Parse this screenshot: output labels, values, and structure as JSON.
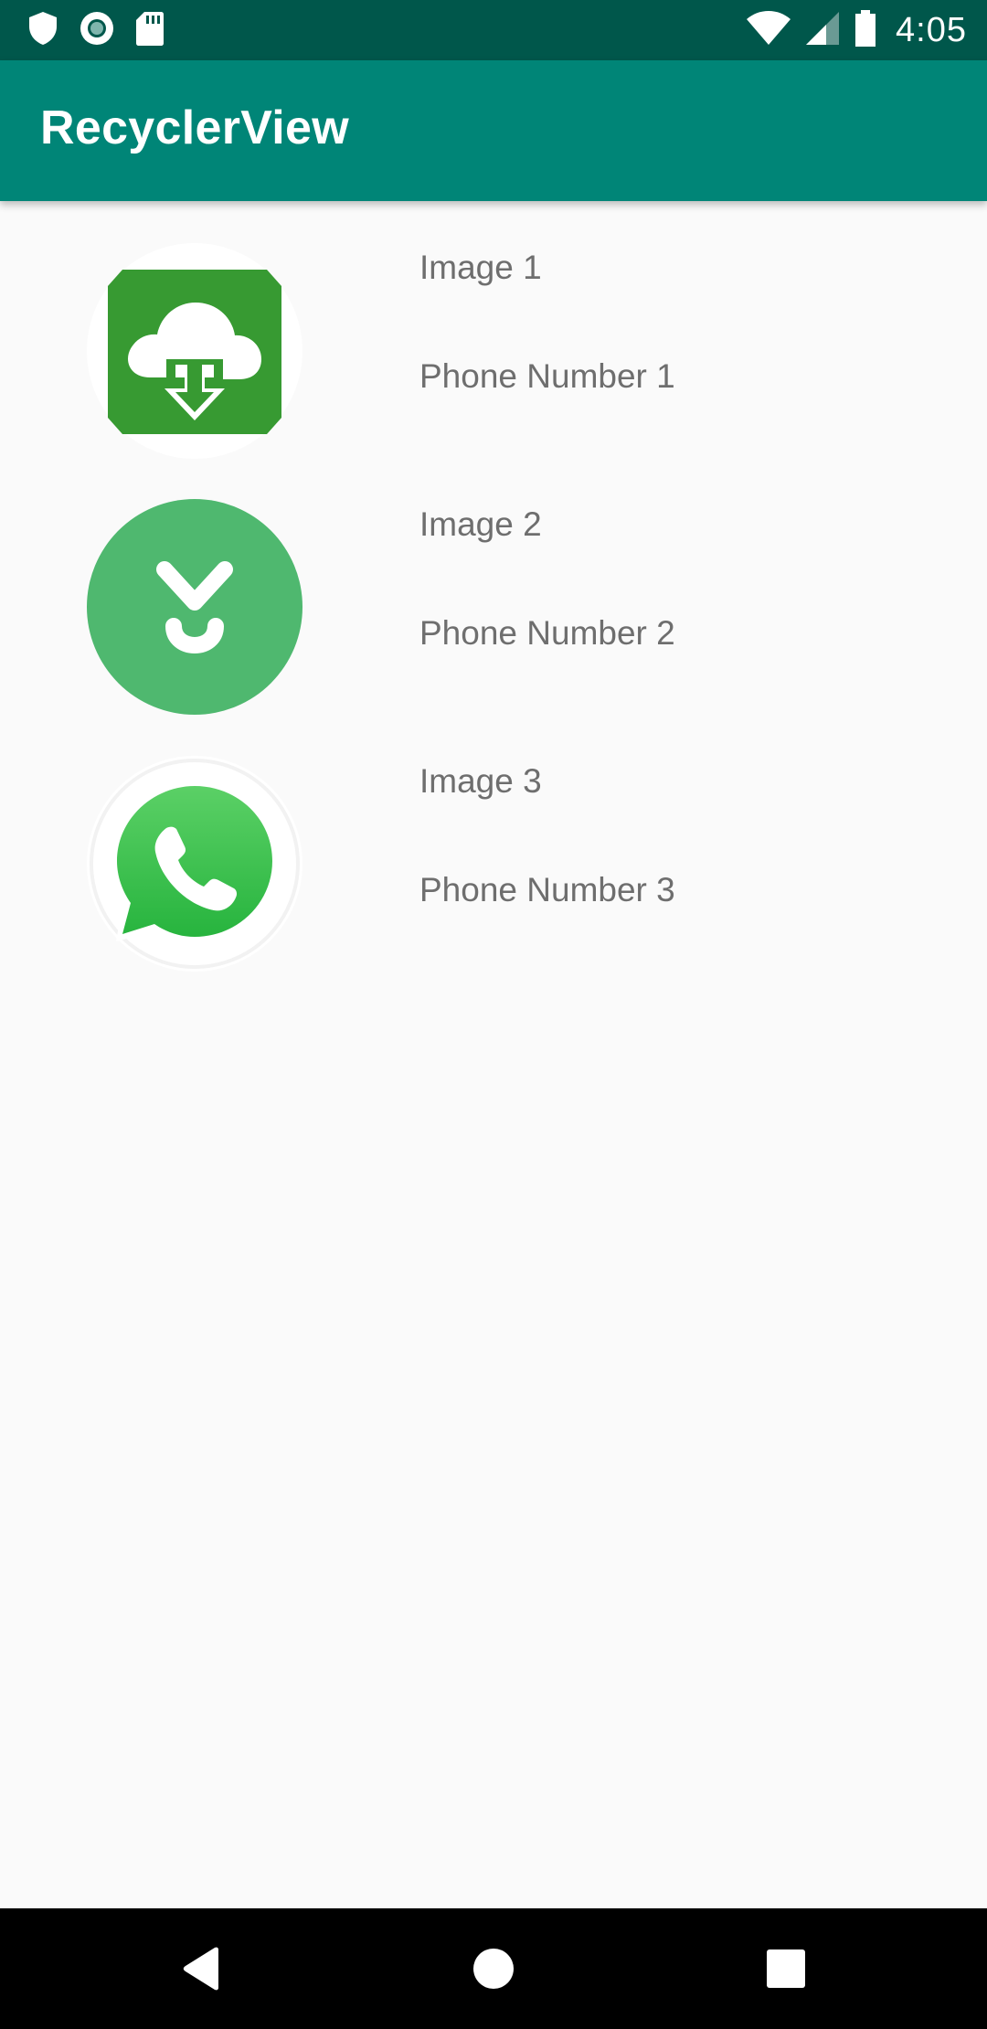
{
  "status_bar": {
    "time": "4:05",
    "left_icons": [
      "shield-icon",
      "record-icon",
      "sd-card-icon"
    ],
    "right_icons": [
      "wifi-icon",
      "cell-signal-icon",
      "battery-icon"
    ]
  },
  "app_bar": {
    "title": "RecyclerView"
  },
  "items": [
    {
      "icon": "cloud-download-icon",
      "title": "Image 1",
      "subtitle": "Phone Number 1"
    },
    {
      "icon": "download-arrow-icon",
      "title": "Image 2",
      "subtitle": "Phone Number 2"
    },
    {
      "icon": "whatsapp-icon",
      "title": "Image 3",
      "subtitle": "Phone Number 3"
    }
  ],
  "nav_bar": {
    "buttons": [
      "back-icon",
      "home-icon",
      "recents-icon"
    ]
  },
  "colors": {
    "status_bar": "#00574b",
    "app_bar": "#008577",
    "background": "#fafafa",
    "text_secondary": "#6e6e6e"
  }
}
